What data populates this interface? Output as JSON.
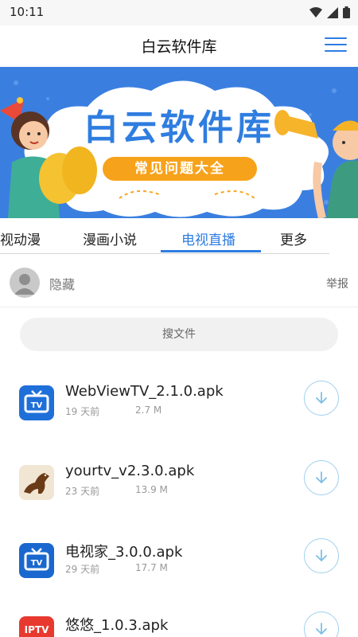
{
  "status_bar": {
    "time": "10:11"
  },
  "header": {
    "title": "白云软件库"
  },
  "banner": {
    "title": "白云软件库",
    "subtitle": "常见问题大全"
  },
  "tabs": [
    {
      "label": "视动漫"
    },
    {
      "label": "漫画小说"
    },
    {
      "label": "电视直播",
      "active": true
    },
    {
      "label": "更多"
    }
  ],
  "user": {
    "name": "隐藏",
    "report_label": "举报"
  },
  "search": {
    "placeholder": "搜文件"
  },
  "files": [
    {
      "name": "WebViewTV_2.1.0.apk",
      "age": "19 天前",
      "size": "2.7 M",
      "icon": "tv-app-icon"
    },
    {
      "name": "yourtv_v2.3.0.apk",
      "age": "23 天前",
      "size": "13.9 M",
      "icon": "horse-app-icon"
    },
    {
      "name": "电视家_3.0.0.apk",
      "age": "29 天前",
      "size": "17.7 M",
      "icon": "tv-live-app-icon"
    },
    {
      "name": "悠悠_1.0.3.apk",
      "age": "",
      "size": "",
      "icon": "iptv-app-icon",
      "icon_label": "IPTV"
    }
  ],
  "colors": {
    "accent": "#2e7de1",
    "download_ring": "#9fd0ee",
    "banner_bg": "#3a7fe0",
    "pill": "#f7a21b"
  }
}
